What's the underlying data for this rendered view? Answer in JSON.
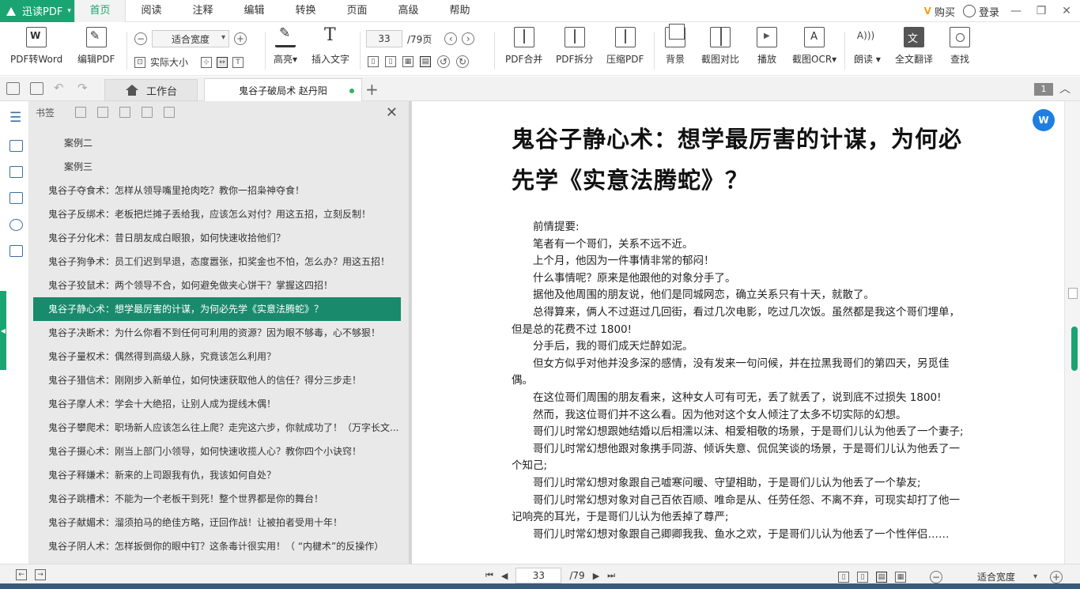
{
  "app": {
    "name": "迅读PDF"
  },
  "menu": [
    "首页",
    "阅读",
    "注释",
    "编辑",
    "转换",
    "页面",
    "高级",
    "帮助"
  ],
  "topRight": {
    "buy": "购买",
    "login": "登录"
  },
  "ribbon": {
    "pdf_to_word": "PDF转Word",
    "edit_pdf": "编辑PDF",
    "zoom_mode": "适合宽度",
    "actual_size": "实际大小",
    "highlight": "高亮",
    "insert_text": "插入文字",
    "current_page": "33",
    "total_pages": "/79页",
    "merge": "PDF合并",
    "split": "PDF拆分",
    "compress": "压缩PDF",
    "background": "背景",
    "compare": "截图对比",
    "play": "播放",
    "ocr": "截图OCR",
    "read_aloud": "朗读",
    "translate": "全文翻译",
    "find": "查找"
  },
  "tabs": {
    "home": "工作台",
    "doc": "鬼谷子破局术 赵丹阳",
    "page_badge": "1"
  },
  "bookmarks": {
    "title": "书签",
    "items": [
      "案例二",
      "案例三",
      "鬼谷子夺食术：怎样从领导嘴里抢肉吃？教你一招枭神夺食！",
      "鬼谷子反绑术：老板把烂摊子丢给我，应该怎么对付？用这五招，立刻反制！",
      "鬼谷子分化术：昔日朋友成白眼狼，如何快速收拾他们？",
      "鬼谷子狗争术：员工们迟到早退，态度嚣张，扣奖金也不怕，怎么办？用这五招！",
      "鬼谷子狡鼠术：两个领导不合，如何避免做夹心饼干？掌握这四招！",
      "鬼谷子静心术：想学最厉害的计谋，为何必先学《实意法腾蛇》？",
      "鬼谷子决断术：为什么你看不到任何可利用的资源？因为眼不够毒，心不够狠！",
      "鬼谷子量权术：偶然得到高级人脉，究竟该怎么利用？",
      "鬼谷子猎信术：刚刚步入新单位，如何快速获取他人的信任？得分三步走！",
      "鬼谷子摩人术：学会十大绝招，让别人成为提线木偶！",
      "鬼谷子攀爬术：职场新人应该怎么往上爬？走完这六步，你就成功了！（万字长文...",
      "鬼谷子摄心术：刚当上部门小领导，如何快速收揽人心？教你四个小诀窍！",
      "鬼谷子释嫌术：新来的上司跟我有仇，我该如何自处？",
      "鬼谷子跳槽术：不能为一个老板干到死！整个世界都是你的舞台！",
      "鬼谷子献媚术：溜须拍马的绝佳方略，迂回作战！让被拍者受用十年！",
      "鬼谷子阴人术：怎样扳倒你的眼中钉？这条毒计很实用！（ “内楗术”的反操作）"
    ]
  },
  "document": {
    "title": "鬼谷子静心术：想学最厉害的计谋，为何必先学《实意法腾蛇》？",
    "paragraphs": [
      "前情提要:",
      "笔者有一个哥们，关系不远不近。",
      "上个月，他因为一件事情非常的郁闷！",
      "什么事情呢？原来是他跟他的对象分手了。",
      "据他及他周围的朋友说，他们是同城网恋，确立关系只有十天，就散了。",
      "总得算来，俩人不过逛过几回街，看过几次电影，吃过几次饭。虽然都是我这个哥们埋单，但是总的花费不过 1800!",
      "分手后，我的哥们成天烂醉如泥。",
      "但女方似乎对他并没多深的感情，没有发来一句问候，并在拉黑我哥们的第四天，另觅佳偶。",
      "在这位哥们周围的朋友看来，这种女人可有可无，丢了就丢了，说到底不过损失 1800!",
      "然而，我这位哥们并不这么看。因为他对这个女人倾注了太多不切实际的幻想。",
      "哥们儿时常幻想跟她结婚以后相濡以沫、相爱相敬的场景，于是哥们儿认为他丢了一个妻子;",
      "哥们儿时常幻想他跟对象携手同游、倾诉失意、侃侃笑谈的场景，于是哥们儿认为他丢了一个知己;",
      "哥们儿时常幻想对象跟自己嘘寒问暖、守望相助，于是哥们儿认为他丢了一个挚友;",
      "哥们儿时常幻想对象对自己百依百顺、唯命是从、任劳任怨、不离不弃，可现实却打了他一记响亮的耳光，于是哥们儿认为他丢掉了尊严;",
      "哥们儿时常幻想对象跟自己卿卿我我、鱼水之欢，于是哥们儿认为他丢了一个性伴侣……"
    ]
  },
  "status": {
    "page": "33",
    "total": "/79",
    "zoom": "适合宽度"
  },
  "colors": {
    "accent": "#1aa472",
    "selected": "#1a8a6c"
  }
}
